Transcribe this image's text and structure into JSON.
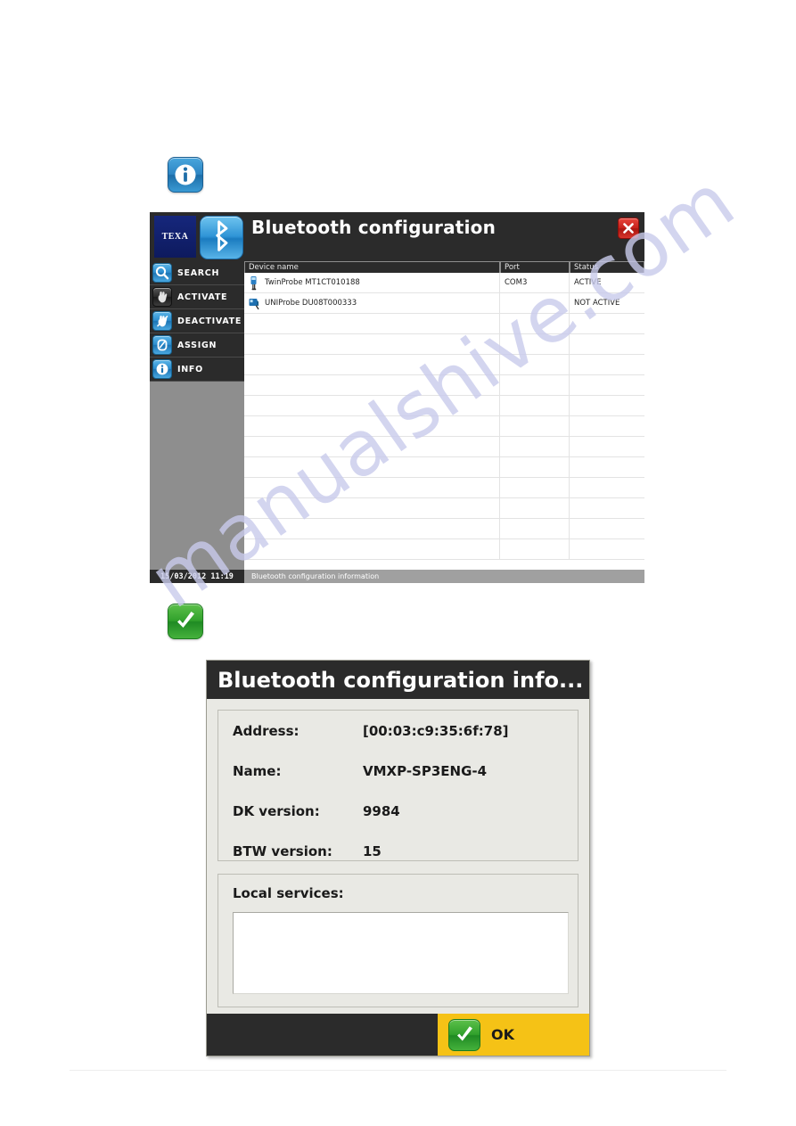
{
  "icons": {
    "info_margin": "info-icon",
    "check_margin": "check-icon"
  },
  "app_window": {
    "logo_text": "TEXA",
    "bluetooth_icon": "bluetooth-icon",
    "title": "Bluetooth configuration",
    "close_icon": "close-icon",
    "sidebar": {
      "items": [
        {
          "label": "SEARCH",
          "icon": "search-icon",
          "icon_style": "blue"
        },
        {
          "label": "ACTIVATE",
          "icon": "hand-icon",
          "icon_style": "dark"
        },
        {
          "label": "DEACTIVATE",
          "icon": "hand-stop-icon",
          "icon_style": "blue"
        },
        {
          "label": "ASSIGN",
          "icon": "link-icon",
          "icon_style": "blue"
        },
        {
          "label": "INFO",
          "icon": "info-icon",
          "icon_style": "blue"
        }
      ]
    },
    "table": {
      "columns": [
        "Device name",
        "Port",
        "Status"
      ],
      "rows": [
        {
          "icon": "twinprobe-device-icon",
          "device": "TwinProbe MT1CT010188",
          "port": "COM3",
          "status": "ACTIVE"
        },
        {
          "icon": "uniprobe-device-icon",
          "device": "UNIProbe DU08T000333",
          "port": "",
          "status": "NOT ACTIVE"
        }
      ],
      "empty_row_count": 12
    },
    "statusbar": {
      "datetime": "15/03/2012 11:19",
      "message": "Bluetooth configuration information"
    }
  },
  "dialog": {
    "title": "Bluetooth configuration info...",
    "fields": [
      {
        "label": "Address:",
        "value": "[00:03:c9:35:6f:78]"
      },
      {
        "label": "Name:",
        "value": "VMXP-SP3ENG-4"
      },
      {
        "label": "DK version:",
        "value": "9984"
      },
      {
        "label": "BTW version:",
        "value": "15"
      }
    ],
    "services_label": "Local services:",
    "services_items": [],
    "ok_label": "OK",
    "ok_icon": "check-icon"
  },
  "watermark": {
    "text": "manualshive.com"
  },
  "colors": {
    "window_chrome": "#2b2b2b",
    "sidebar_fill": "#8e8e8e",
    "accent_yellow": "#f5c216",
    "accent_green": "#31a12c",
    "accent_blue": "#2c8ccd",
    "close_red": "#c5201a"
  }
}
